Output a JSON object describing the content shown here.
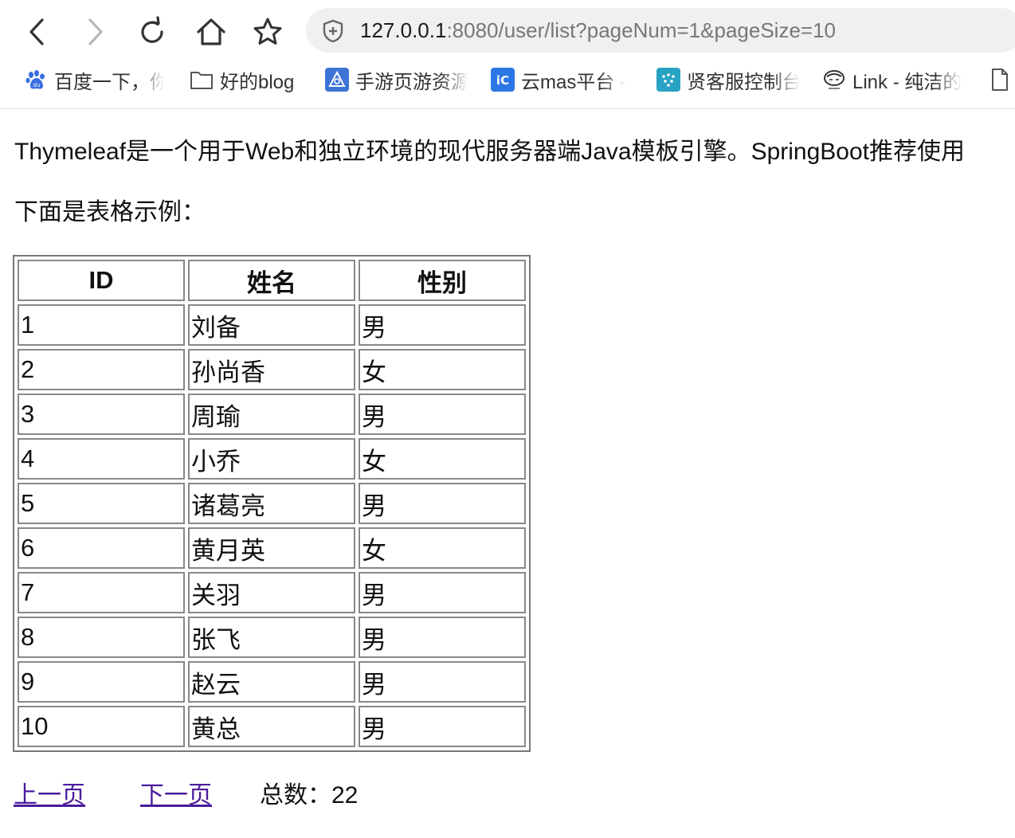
{
  "browser": {
    "url_host": "127.0.0.1",
    "url_rest": ":8080/user/list?pageNum=1&pageSize=10",
    "nav_icons": [
      "back-icon",
      "forward-icon",
      "reload-icon",
      "home-icon",
      "bookmark-star-icon"
    ],
    "bookmarks": [
      {
        "label": "百度一下，你",
        "icon": "baidu-paw-icon",
        "color": "#3b6fe0"
      },
      {
        "label": "好的blog",
        "icon": "folder-icon",
        "color": "#555555"
      },
      {
        "label": "手游页游资源",
        "icon": "game-site-icon",
        "color": "#3d74d6"
      },
      {
        "label": "云mas平台 -",
        "icon": "yunmas-icon",
        "color": "#2b78e4"
      },
      {
        "label": "贤客服控制台",
        "icon": "kefu-icon",
        "color": "#29a3c4"
      },
      {
        "label": "Link - 纯洁的",
        "icon": "link-avatar-icon",
        "color": "#333333"
      },
      {
        "label": "",
        "icon": "page-icon",
        "color": "#555555"
      }
    ]
  },
  "page": {
    "intro": "Thymeleaf是一个用于Web和独立环境的现代服务器端Java模板引擎。SpringBoot推荐使用",
    "subtitle": "下面是表格示例：",
    "table": {
      "headers": [
        "ID",
        "姓名",
        "性别"
      ],
      "rows": [
        [
          "1",
          "刘备",
          "男"
        ],
        [
          "2",
          "孙尚香",
          "女"
        ],
        [
          "3",
          "周瑜",
          "男"
        ],
        [
          "4",
          "小乔",
          "女"
        ],
        [
          "5",
          "诸葛亮",
          "男"
        ],
        [
          "6",
          "黄月英",
          "女"
        ],
        [
          "7",
          "关羽",
          "男"
        ],
        [
          "8",
          "张飞",
          "男"
        ],
        [
          "9",
          "赵云",
          "男"
        ],
        [
          "10",
          "黄总",
          "男"
        ]
      ]
    },
    "pager": {
      "prev_label": "上一页",
      "next_label": "下一页",
      "total_label": "总数：",
      "total_value": "22",
      "link_color": "#4a1b9b"
    }
  }
}
